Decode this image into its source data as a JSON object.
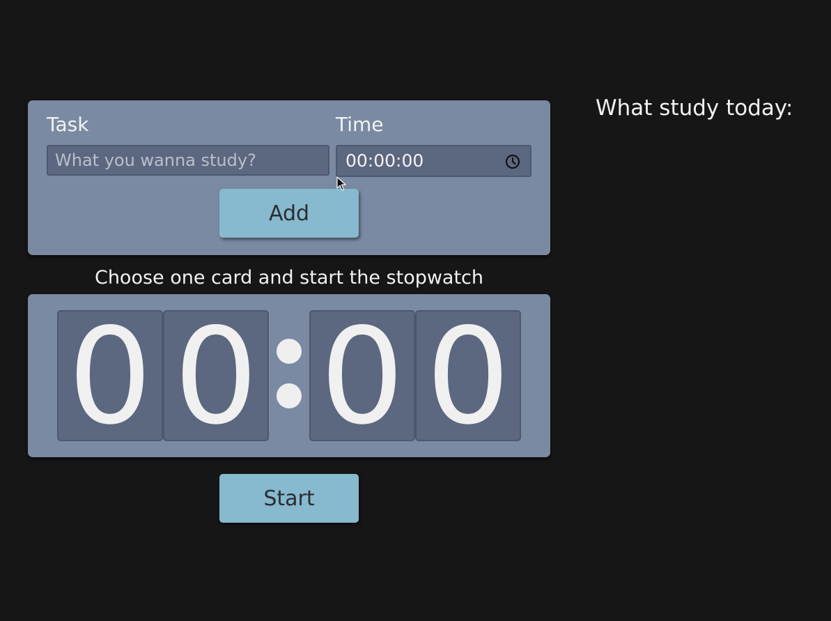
{
  "form": {
    "task_label": "Task",
    "time_label": "Time",
    "task_placeholder": "What you wanna study?",
    "task_value": "",
    "time_value": "00:00:00",
    "time_icon": "clock-icon",
    "add_label": "Add"
  },
  "stopwatch": {
    "instruction": "Choose one card and start the stopwatch",
    "digits": [
      "0",
      "0",
      "0",
      "0"
    ],
    "start_label": "Start"
  },
  "sidebar": {
    "title": "What study today:"
  },
  "colors": {
    "background": "#161616",
    "card": "#7a8aa3",
    "field": "#5c6780",
    "button": "#87b9cf"
  }
}
